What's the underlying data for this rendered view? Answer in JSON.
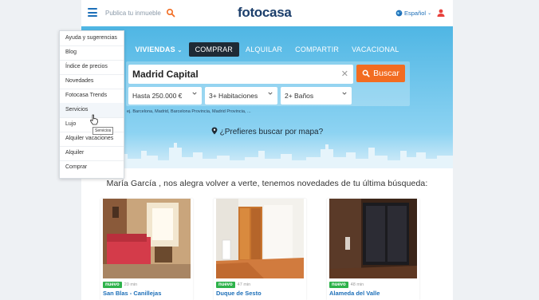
{
  "header": {
    "search_placeholder": "Publica tu inmueble",
    "logo": "fotocasa",
    "language": "Español"
  },
  "hero": {
    "tabs": [
      {
        "label": "VIVIENDAS"
      },
      {
        "label": "COMPRAR"
      },
      {
        "label": "ALQUILAR"
      },
      {
        "label": "COMPARTIR"
      },
      {
        "label": "VACACIONAL"
      }
    ],
    "location_value": "Madrid Capital",
    "search_button": "Buscar",
    "price_select": "Hasta 250.000 €",
    "rooms_select": "3+ Habitaciones",
    "baths_select": "2+ Baños",
    "suggestions": "ej. Barcelona, Madrid, Barcelona Provincia, Madrid Provincia, ...",
    "map_link": "¿Prefieres buscar por mapa?"
  },
  "welcome": "María García , nos alegra volver a verte, tenemos novedades de tu última búsqueda:",
  "cards": [
    {
      "badge": "nuevo",
      "time": "20 min",
      "title": "San Blas - Canillejas"
    },
    {
      "badge": "nuevo",
      "time": "47 min",
      "title": "Duque de Sesto"
    },
    {
      "badge": "nuevo",
      "time": "48 min",
      "title": "Alameda del Valle"
    }
  ],
  "menu": {
    "items": [
      {
        "label": "Ayuda y sugerencias"
      },
      {
        "label": "Blog"
      },
      {
        "label": "Índice de precios"
      },
      {
        "label": "Novedades"
      },
      {
        "label": "Fotocasa Trends"
      },
      {
        "label": "Servicios"
      },
      {
        "label": "Lujo"
      },
      {
        "label": "Alquiler vacaciones"
      },
      {
        "label": "Alquiler"
      },
      {
        "label": "Comprar"
      }
    ],
    "tooltip": "Servicios"
  },
  "colors": {
    "accent": "#1d6fb8",
    "orange": "#f26c21",
    "badge_green": "#2eb24b",
    "dark": "#1e2a35"
  }
}
